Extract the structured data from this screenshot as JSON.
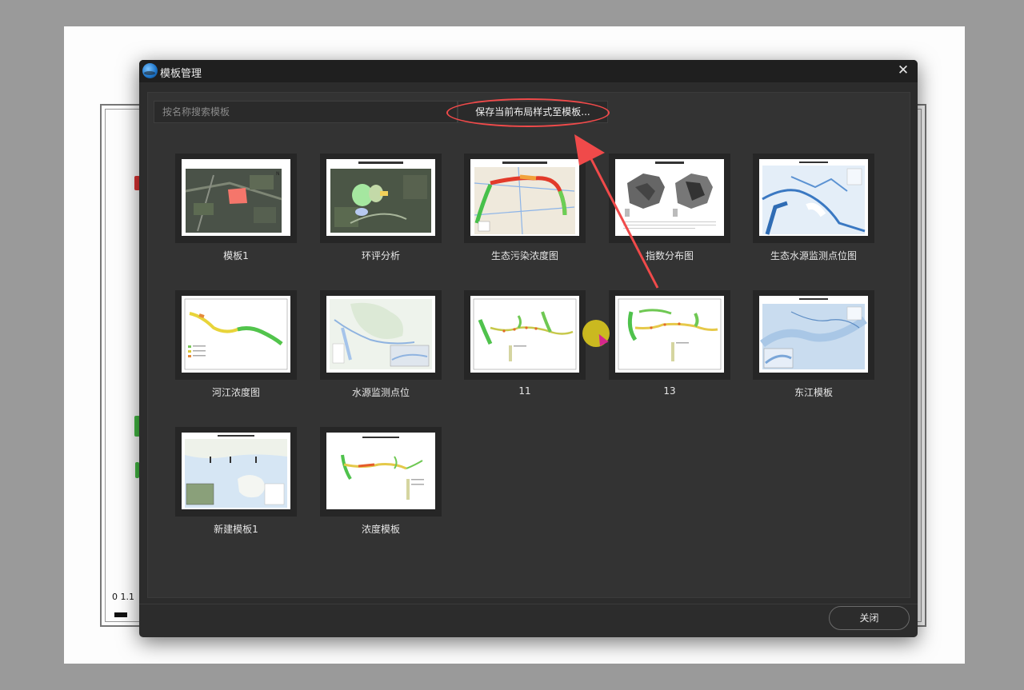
{
  "dialog": {
    "title": "模板管理",
    "close_icon_glyph": "✕",
    "search": {
      "placeholder": "按名称搜索模板",
      "value": ""
    },
    "save_button_label": "保存当前布局样式至模板...",
    "close_button_label": "关闭"
  },
  "templates": [
    {
      "label": "模板1",
      "style": "satellite"
    },
    {
      "label": "环评分析",
      "style": "satellite-zones"
    },
    {
      "label": "生态污染浓度图",
      "style": "heat-river"
    },
    {
      "label": "指数分布图",
      "style": "two-maps"
    },
    {
      "label": "生态水源监测点位图",
      "style": "blue-river"
    },
    {
      "label": "河江浓度图",
      "style": "river-yellow"
    },
    {
      "label": "水源监测点位",
      "style": "light-map"
    },
    {
      "label": "11",
      "style": "river-green"
    },
    {
      "label": "13",
      "style": "river-green2"
    },
    {
      "label": "东江模板",
      "style": "blue-map"
    },
    {
      "label": "新建模板1",
      "style": "coast"
    },
    {
      "label": "浓度模板",
      "style": "river-small"
    }
  ],
  "background": {
    "scale_text": "0  1.1"
  },
  "colors": {
    "dialog_bg": "#2c2c2c",
    "titlebar_bg": "#1f1f1f",
    "annotation_red": "#f04a4a",
    "cursor_yellow": "#dac81e"
  }
}
